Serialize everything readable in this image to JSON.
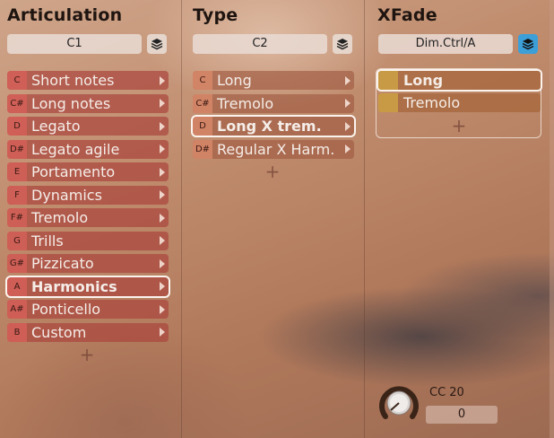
{
  "articulation": {
    "heading": "Articulation",
    "selector_value": "C1",
    "items": [
      {
        "key": "C",
        "label": "Short notes"
      },
      {
        "key": "C#",
        "label": "Long notes"
      },
      {
        "key": "D",
        "label": "Legato"
      },
      {
        "key": "D#",
        "label": "Legato agile"
      },
      {
        "key": "E",
        "label": "Portamento"
      },
      {
        "key": "F",
        "label": "Dynamics"
      },
      {
        "key": "F#",
        "label": "Tremolo"
      },
      {
        "key": "G",
        "label": "Trills"
      },
      {
        "key": "G#",
        "label": "Pizzicato"
      },
      {
        "key": "A",
        "label": "Harmonics",
        "selected": true
      },
      {
        "key": "A#",
        "label": "Ponticello"
      },
      {
        "key": "B",
        "label": "Custom"
      }
    ],
    "add_symbol": "+"
  },
  "type": {
    "heading": "Type",
    "selector_value": "C2",
    "items": [
      {
        "key": "C",
        "label": "Long"
      },
      {
        "key": "C#",
        "label": "Tremolo"
      },
      {
        "key": "D",
        "label": "Long X trem.",
        "selected": true
      },
      {
        "key": "D#",
        "label": "Regular X Harm."
      }
    ],
    "add_symbol": "+"
  },
  "xfade": {
    "heading": "XFade",
    "selector_value": "Dim.Ctrl/A",
    "layers_active": true,
    "items": [
      {
        "label": "Long",
        "selected": true
      },
      {
        "label": "Tremolo"
      }
    ],
    "add_symbol": "+",
    "cc_label": "CC 20",
    "cc_value": "0"
  },
  "colors": {
    "accent_blue": "#3d9fd8",
    "articulation_row": "#aa463e",
    "type_row": "#a05a42",
    "xfade_swatch": "#c99a45"
  }
}
